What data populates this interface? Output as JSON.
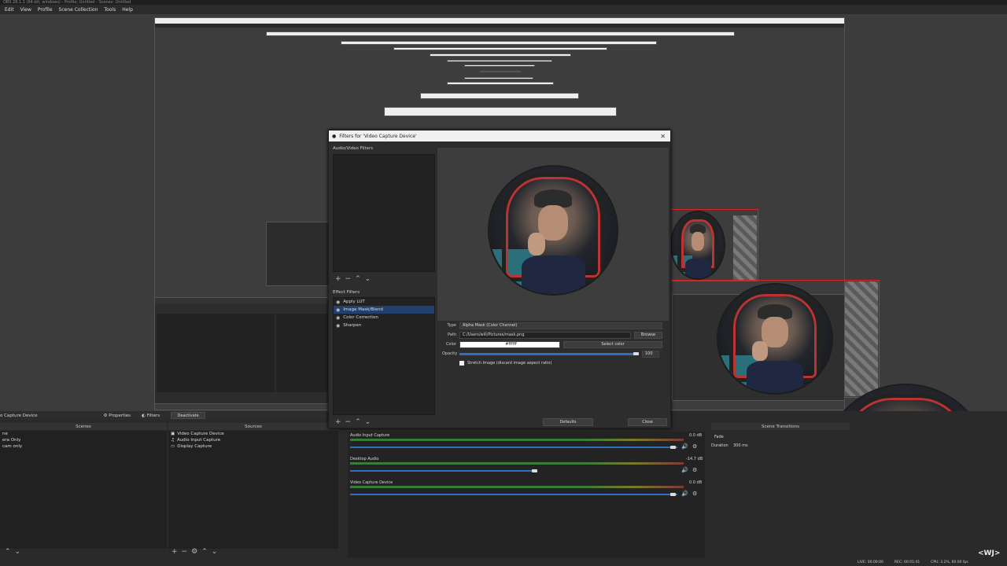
{
  "window": {
    "title": "OBS 26.1.1 (64-bit, windows) - Profile: Untitled - Scenes: Untitled"
  },
  "menu": [
    "Edit",
    "View",
    "Profile",
    "Scene Collection",
    "Tools",
    "Help"
  ],
  "dialog": {
    "title": "Filters for 'Video Capture Device'",
    "av_filters_label": "Audio/Video Filters",
    "effect_filters_label": "Effect Filters",
    "effect_filters": [
      {
        "label": "Apply LUT",
        "selected": false
      },
      {
        "label": "Image Mask/Blend",
        "selected": true
      },
      {
        "label": "Color Correction",
        "selected": false
      },
      {
        "label": "Sharpen",
        "selected": false
      }
    ],
    "props": {
      "type_label": "Type",
      "type_value": "Alpha Mask (Color Channel)",
      "path_label": "Path",
      "path_value": "C:/Users/will/Pictures/mask.png",
      "browse": "Browse",
      "color_label": "Color",
      "color_value": "#ffffff",
      "select_color": "Select color",
      "opacity_label": "Opacity",
      "opacity_value": "100",
      "stretch_label": "Stretch Image (discard image aspect ratio)"
    },
    "defaults": "Defaults",
    "close": "Close"
  },
  "source_toolbar": {
    "source_name": "o Capture Device",
    "properties": "Properties",
    "filters": "Filters",
    "deactivate": "Deactivate"
  },
  "scenes": {
    "header": "Scenes",
    "items": [
      "ne",
      "era Only",
      "cam only"
    ]
  },
  "sources": {
    "header": "Sources",
    "items": [
      "Video Capture Device",
      "Audio Input Capture",
      "Display Capture"
    ]
  },
  "mixer": {
    "channels": [
      {
        "name": "Audio Input Capture",
        "db": "0.0 dB"
      },
      {
        "name": "Desktop Audio",
        "db": "-14.7 dB"
      },
      {
        "name": "Video Capture Device",
        "db": "0.0 dB"
      }
    ]
  },
  "transitions": {
    "header": "Scene Transitions",
    "type": "Fade",
    "duration_label": "Duration",
    "duration_value": "300 ms"
  },
  "status": {
    "live": "LIVE: 00:00:00",
    "rec": "REC: 00:01:41",
    "cpu": "CPU: 3.2%, 60.00 fps"
  },
  "watermark": "<WJ>"
}
